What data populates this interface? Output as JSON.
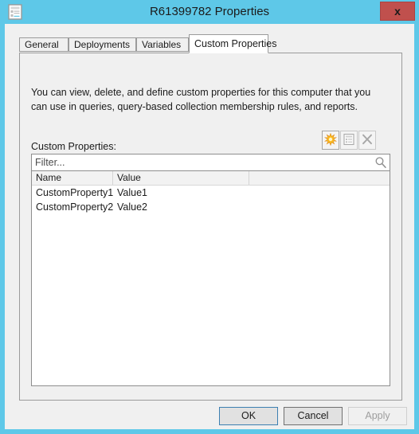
{
  "window": {
    "title": "R61399782 Properties",
    "icon": "properties-document-icon",
    "close_label": "x",
    "frame_color": "#5ec8e8",
    "close_color": "#c0504d"
  },
  "tabs": [
    {
      "label": "General",
      "selected": false
    },
    {
      "label": "Deployments",
      "selected": false
    },
    {
      "label": "Variables",
      "selected": false
    },
    {
      "label": "Custom Properties",
      "selected": true
    }
  ],
  "panel": {
    "description": "You can view, delete, and define custom properties for this computer that you can use in queries, query-based collection membership rules, and reports.",
    "list_label": "Custom Properties:"
  },
  "toolbar": {
    "buttons": [
      {
        "name": "new-property-button",
        "icon": "starburst-icon",
        "enabled": true
      },
      {
        "name": "edit-property-button",
        "icon": "properties-icon",
        "enabled": false
      },
      {
        "name": "delete-property-button",
        "icon": "x-delete-icon",
        "enabled": false
      }
    ]
  },
  "filter": {
    "value": "",
    "placeholder": "Filter...",
    "search_icon": "magnifier-icon"
  },
  "list": {
    "columns": [
      "Name",
      "Value"
    ],
    "rows": [
      {
        "name": "CustomProperty1",
        "value": "Value1"
      },
      {
        "name": "CustomProperty2",
        "value": "Value2"
      }
    ]
  },
  "footer": {
    "ok": "OK",
    "cancel": "Cancel",
    "apply": "Apply",
    "apply_enabled": false
  }
}
